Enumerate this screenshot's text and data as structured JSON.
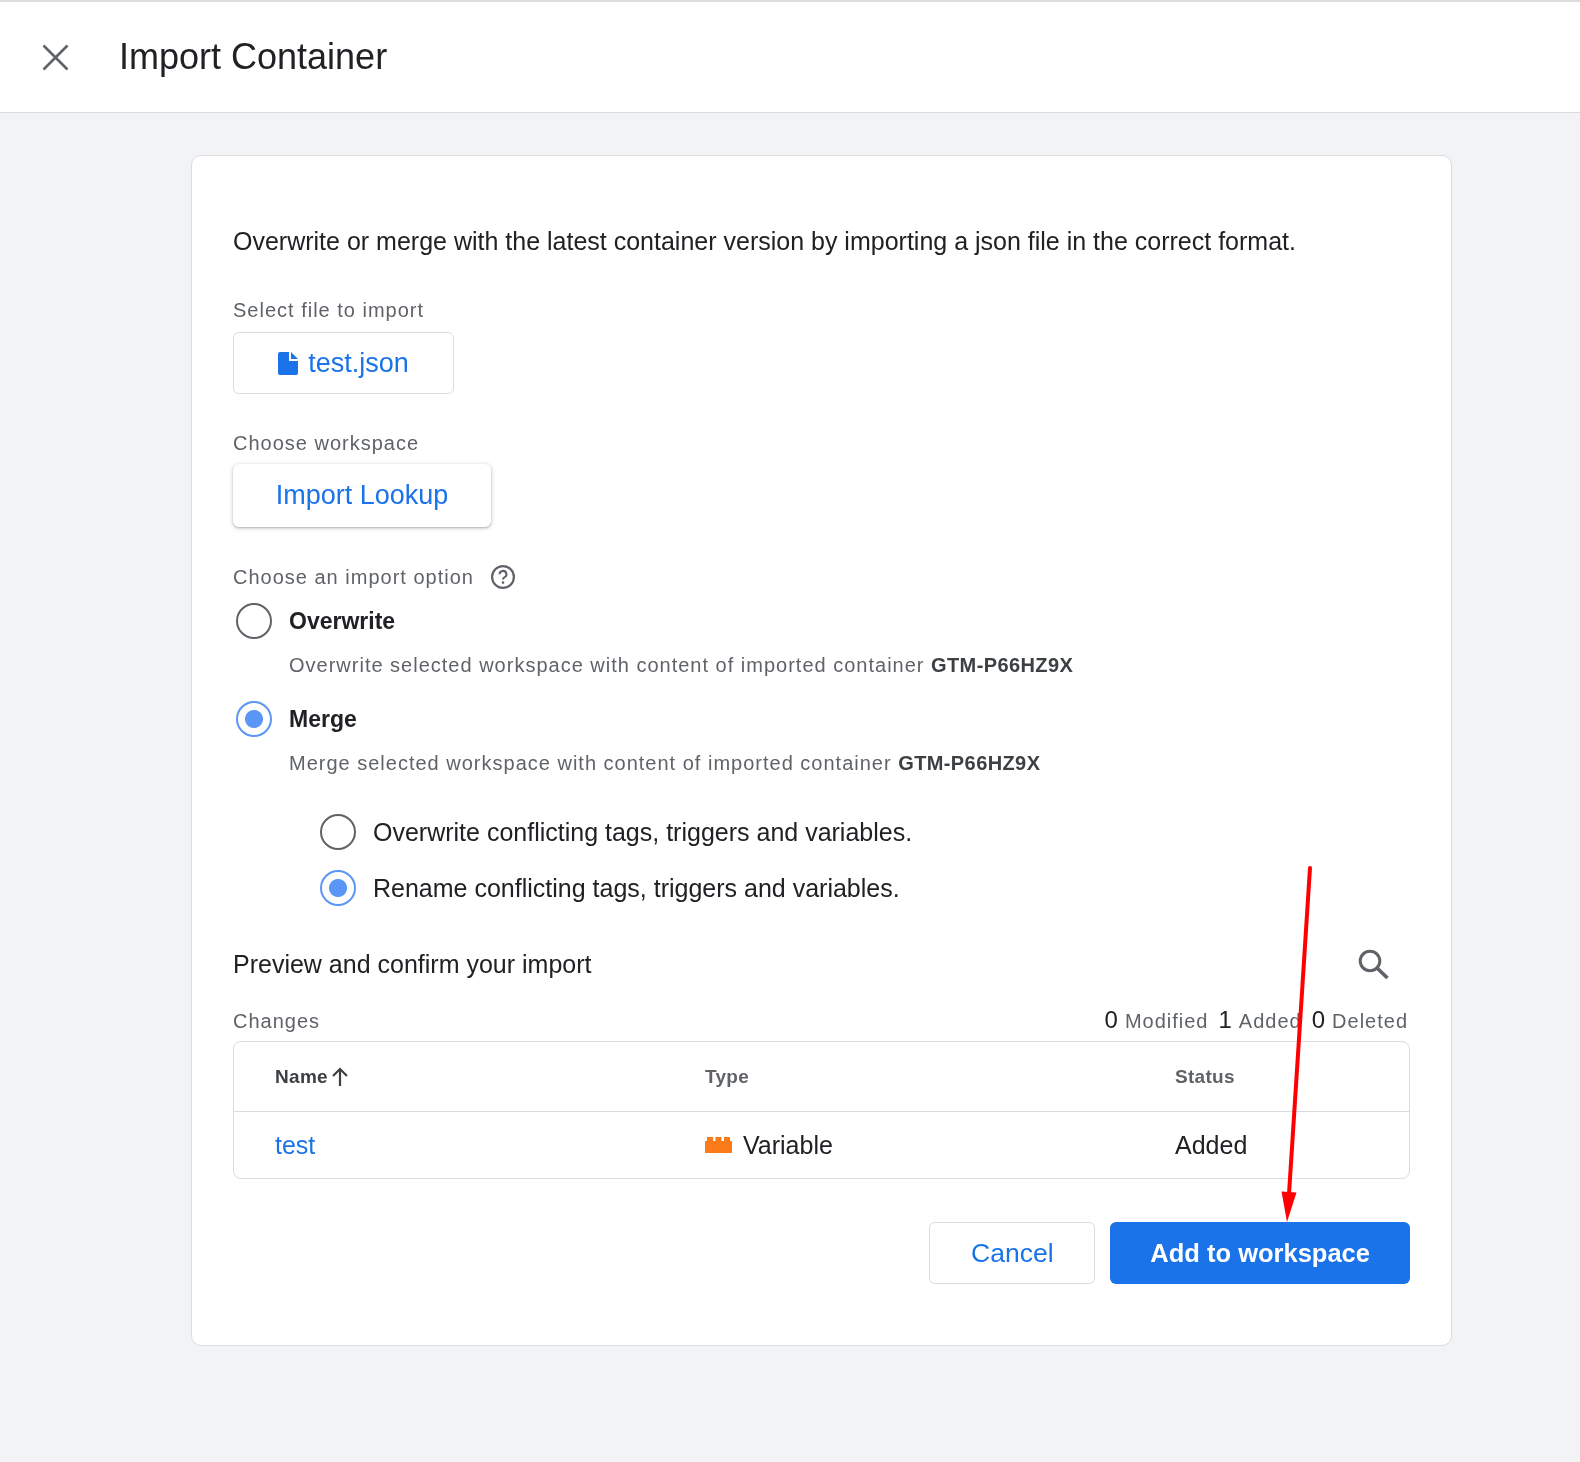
{
  "header": {
    "title": "Import Container"
  },
  "intro": "Overwrite or merge with the latest container version by importing a json file in the correct format.",
  "file_picker": {
    "label": "Select file to import",
    "file_name": "test.json"
  },
  "workspace": {
    "label": "Choose workspace",
    "value": "Import Lookup"
  },
  "import_option": {
    "label": "Choose an import option",
    "options": [
      {
        "label": "Overwrite",
        "description": "Overwrite selected workspace with content of imported container **GTM-P66HZ9X**",
        "selected": false
      },
      {
        "label": "Merge",
        "description": "Merge selected workspace with content of imported container **GTM-P66HZ9X**",
        "selected": true,
        "sub_options": [
          {
            "label": "Overwrite conflicting tags, triggers and variables.",
            "selected": false
          },
          {
            "label": "Rename conflicting tags, triggers and variables.",
            "selected": true
          }
        ]
      }
    ]
  },
  "preview": {
    "title": "Preview and confirm your import",
    "changes_label": "Changes",
    "counts": [
      {
        "number": "0",
        "change": "Modified"
      },
      {
        "number": "1",
        "change": "Added"
      },
      {
        "number": "0",
        "change": "Deleted"
      }
    ],
    "table": {
      "columns": [
        {
          "label": "Name",
          "sorted": true
        },
        {
          "label": "Type",
          "sorted": false
        },
        {
          "label": "Status",
          "sorted": false
        }
      ],
      "rows": [
        {
          "name": "test",
          "type": {
            "label": "Variable",
            "kind": "variable"
          },
          "status": "Added"
        }
      ]
    }
  },
  "buttons": [
    {
      "label": "Cancel",
      "kind": "secondary"
    },
    {
      "label": "Add to workspace",
      "kind": "primary"
    }
  ]
}
